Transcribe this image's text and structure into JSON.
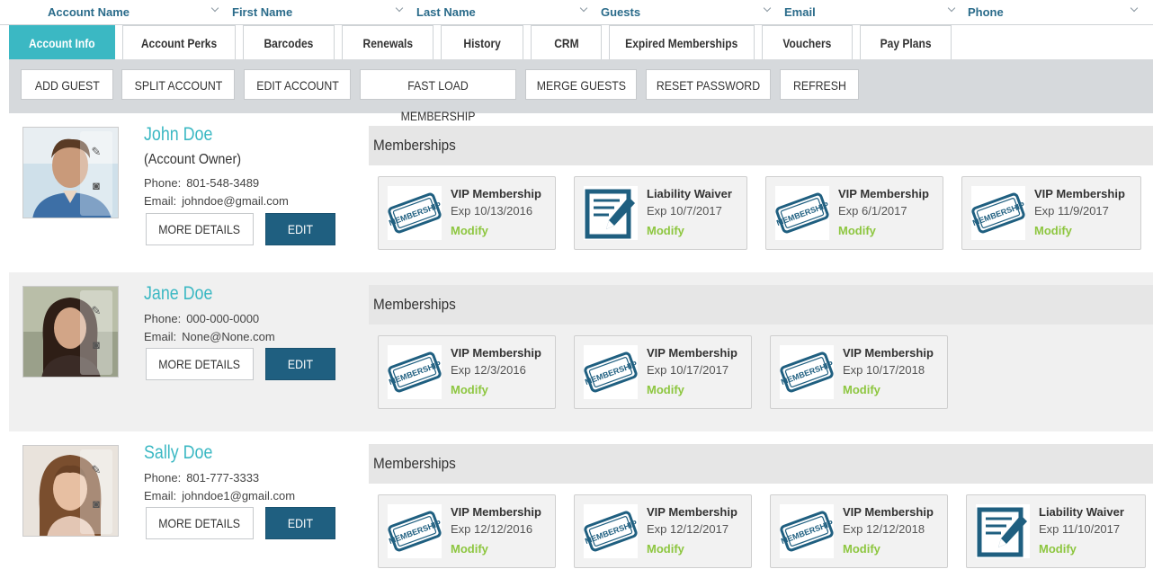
{
  "columns": [
    {
      "label": "Account Name"
    },
    {
      "label": "First Name"
    },
    {
      "label": "Last Name"
    },
    {
      "label": "Guests"
    },
    {
      "label": "Email"
    },
    {
      "label": "Phone"
    }
  ],
  "tabs": [
    {
      "label": "Account Info",
      "active": true
    },
    {
      "label": "Account Perks"
    },
    {
      "label": "Barcodes"
    },
    {
      "label": "Renewals"
    },
    {
      "label": "History"
    },
    {
      "label": "CRM"
    },
    {
      "label": "Expired Memberships"
    },
    {
      "label": "Vouchers"
    },
    {
      "label": "Pay Plans"
    }
  ],
  "actions": [
    {
      "label": "ADD GUEST"
    },
    {
      "label": "SPLIT ACCOUNT"
    },
    {
      "label": "EDIT ACCOUNT"
    },
    {
      "label": "FAST LOAD MEMBERSHIP"
    },
    {
      "label": "MERGE GUESTS"
    },
    {
      "label": "RESET PASSWORD"
    },
    {
      "label": "REFRESH"
    }
  ],
  "colors": {
    "accent": "#3bb8c3",
    "edit": "#1f5f80",
    "modify": "#8dc63f",
    "icon": "#1f5f80"
  },
  "labels": {
    "phone": "Phone:",
    "email": "Email:",
    "more_details": "MORE DETAILS",
    "edit": "EDIT",
    "memberships": "Memberships",
    "modify": "Modify"
  },
  "guests": [
    {
      "name": "John Doe",
      "role": "(Account Owner)",
      "phone": "801-548-3489",
      "email": "johndoe@gmail.com",
      "memberships": [
        {
          "title": "VIP Membership",
          "exp": "Exp 10/13/2016",
          "icon": "membership-stamp-icon"
        },
        {
          "title": "Liability Waiver",
          "exp": "Exp 10/7/2017",
          "icon": "waiver-icon"
        },
        {
          "title": "VIP Membership",
          "exp": "Exp 6/1/2017",
          "icon": "membership-stamp-icon"
        },
        {
          "title": "VIP Membership",
          "exp": "Exp 11/9/2017",
          "icon": "membership-stamp-icon"
        }
      ]
    },
    {
      "name": "Jane Doe",
      "phone": "000-000-0000",
      "email": "None@None.com",
      "memberships": [
        {
          "title": "VIP Membership",
          "exp": "Exp 12/3/2016",
          "icon": "membership-stamp-icon"
        },
        {
          "title": "VIP Membership",
          "exp": "Exp 10/17/2017",
          "icon": "membership-stamp-icon"
        },
        {
          "title": "VIP Membership",
          "exp": "Exp 10/17/2018",
          "icon": "membership-stamp-icon"
        }
      ]
    },
    {
      "name": "Sally Doe",
      "phone": "801-777-3333",
      "email": "johndoe1@gmail.com",
      "memberships": [
        {
          "title": "VIP Membership",
          "exp": "Exp 12/12/2016",
          "icon": "membership-stamp-icon"
        },
        {
          "title": "VIP Membership",
          "exp": "Exp 12/12/2017",
          "icon": "membership-stamp-icon"
        },
        {
          "title": "VIP Membership",
          "exp": "Exp 12/12/2018",
          "icon": "membership-stamp-icon"
        },
        {
          "title": "Liability Waiver",
          "exp": "Exp 11/10/2017",
          "icon": "waiver-icon"
        }
      ]
    }
  ]
}
